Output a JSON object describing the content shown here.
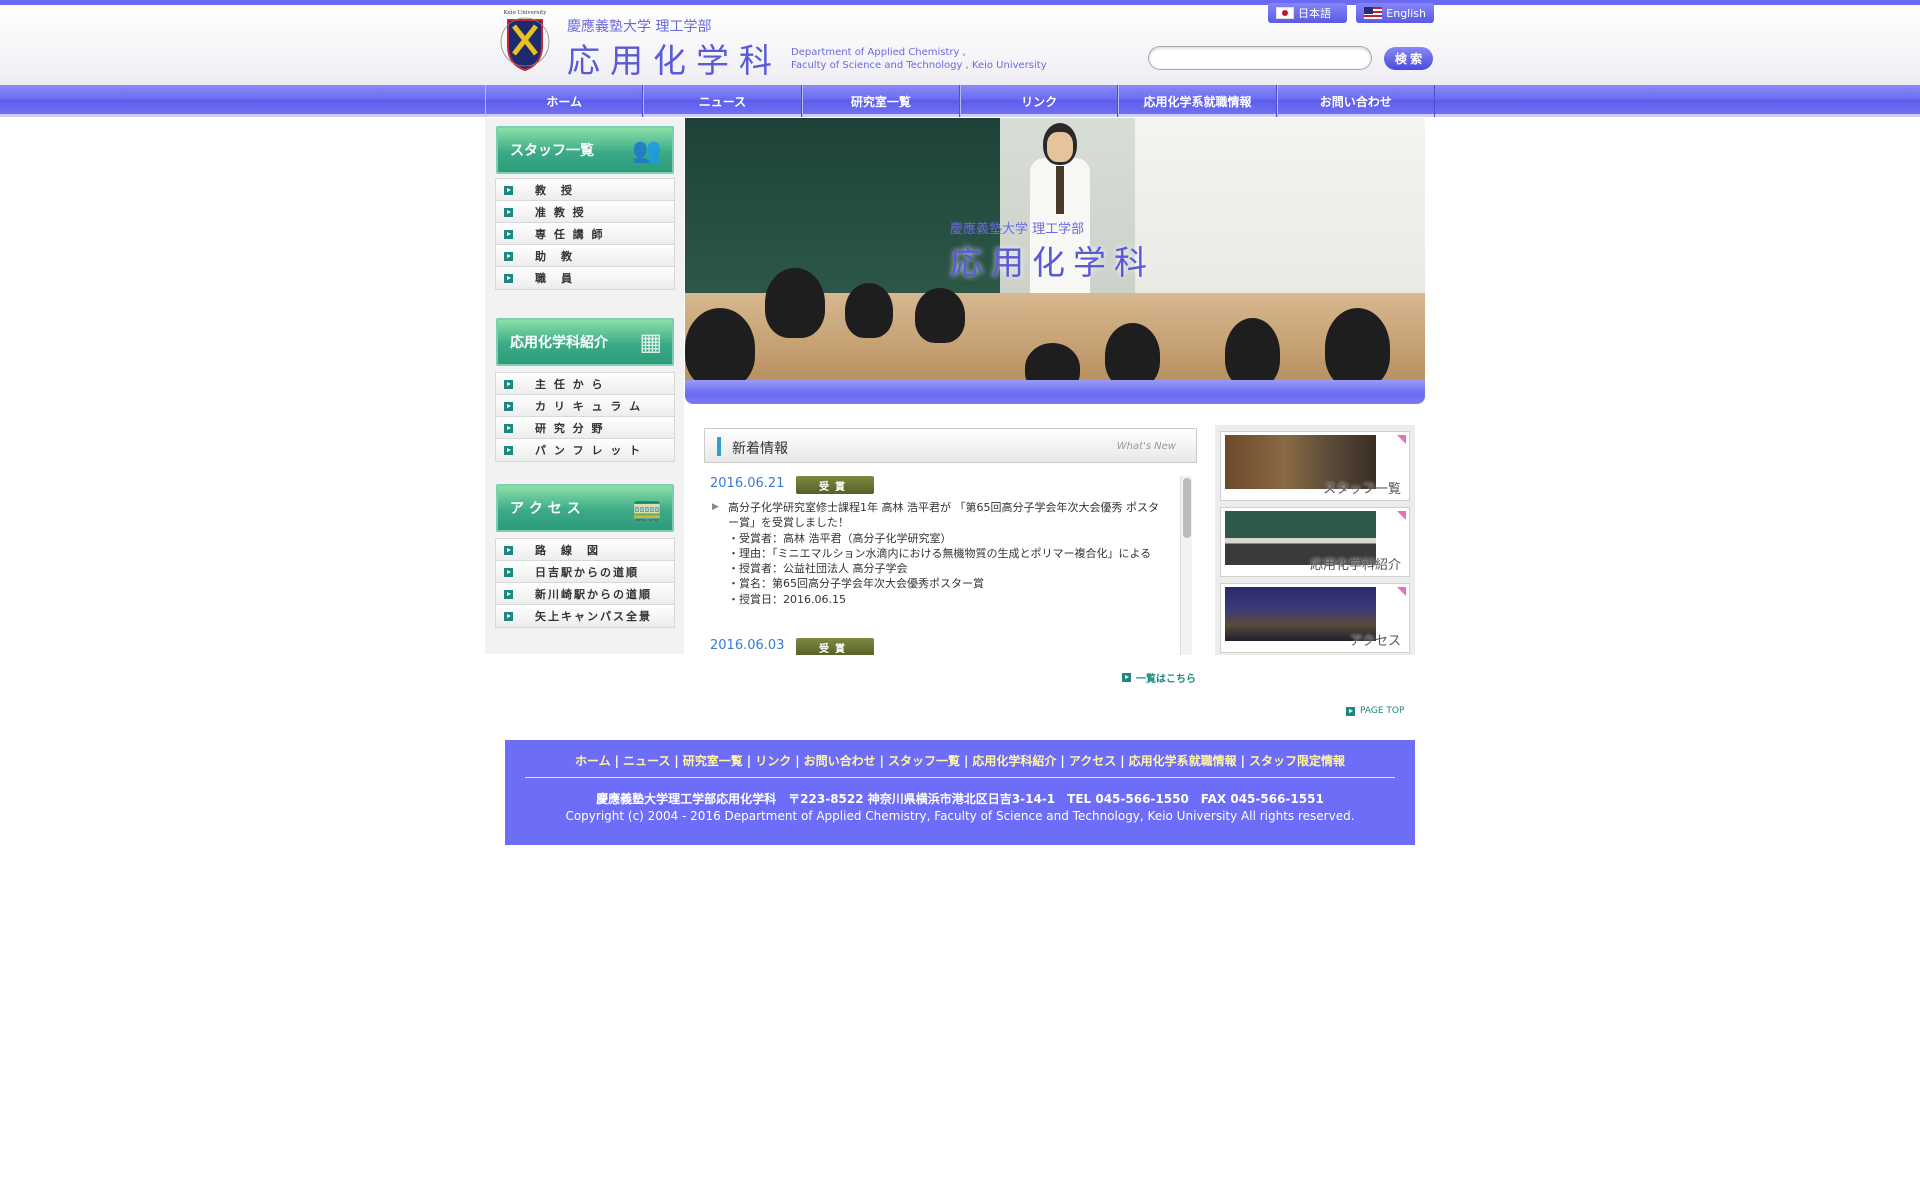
{
  "header": {
    "emblem_text": "Keio University",
    "subtitle": "慶應義塾大学 理工学部",
    "title": "応用化学科",
    "english_line1": "Department of Applied Chemistry ,",
    "english_line2": "Faculty of Science and Technology , Keio University",
    "lang_jp": "日本語",
    "lang_en": "English",
    "search_placeholder": "",
    "search_button": "検 索"
  },
  "nav": [
    "ホーム",
    "ニュース",
    "研究室一覧",
    "リンク",
    "応用化学系就職情報",
    "お問い合わせ"
  ],
  "sidebar": {
    "staff_heading": "スタッフ一覧",
    "staff_items": [
      "教　授",
      "准 教 授",
      "専 任 講 師",
      "助　教",
      "職　員"
    ],
    "intro_heading": "応用化学科紹介",
    "intro_items": [
      "主 任 か ら",
      "カ リ キ ュ ラ ム",
      "研 究 分 野",
      "パ ン フ レ ッ ト"
    ],
    "access_heading": "ア ク セ ス",
    "access_items": [
      "路　線　図",
      "日吉駅からの道順",
      "新川崎駅からの道順",
      "矢上キャンパス全景"
    ]
  },
  "hero": {
    "subtitle": "慶應義塾大学 理工学部",
    "title": "応用化学科"
  },
  "news": {
    "heading": "新着情報",
    "heading_en": "What's New",
    "items": [
      {
        "date": "2016.06.21",
        "badge": "受賞",
        "lines": [
          "高分子化学研究室修士課程1年 高林 浩平君が 「第65回高分子学会年次大会優秀 ポスター賞」を受賞しました！",
          "・受賞者：高林 浩平君（高分子化学研究室）",
          "・理由：「ミニエマルション水滴内における無機物質の生成とポリマー複合化」による",
          "・授賞者：公益社団法人 高分子学会",
          "・賞名：第65回高分子学会年次大会優秀ポスター賞",
          "・授賞日：2016.06.15"
        ]
      },
      {
        "date": "2016.06.03",
        "badge": "受賞"
      }
    ],
    "more": "一覧はこちら"
  },
  "banners": [
    {
      "label": "スタッフ一覧"
    },
    {
      "label": "応用化学科紹介"
    },
    {
      "label": "アクセス"
    }
  ],
  "pagetop": "PAGE TOP",
  "footer": {
    "links": [
      "ホーム",
      "ニュース",
      "研究室一覧",
      "リンク",
      "お問い合わせ",
      "スタッフ一覧",
      "応用化学科紹介",
      "アクセス",
      "応用化学系就職情報",
      "スタッフ限定情報"
    ],
    "address": "慶應義塾大学理工学部応用化学科　〒223-8522 神奈川県横浜市港北区日吉3-14-1　TEL 045-566-1550　FAX 045-566-1551",
    "copyright": "Copyright (c) 2004 - 2016 Department of Applied Chemistry, Faculty of Science and Technology, Keio University All rights reserved."
  },
  "colors": {
    "accent": "#6d6df8",
    "sidebar_heading": "#3dab87",
    "news_date": "#3a7ad0",
    "badge": "#6a7434",
    "footer_link": "#fff6a0"
  }
}
